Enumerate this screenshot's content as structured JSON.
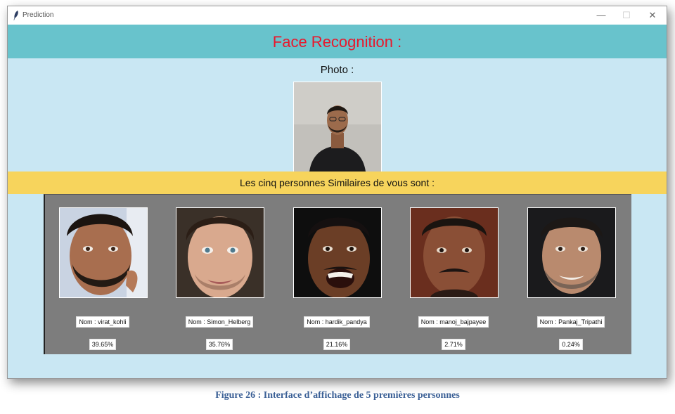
{
  "window": {
    "title": "Prediction",
    "icon": "feather-icon"
  },
  "controls": {
    "minimize": "—",
    "maximize": "☐",
    "close": "✕"
  },
  "header": {
    "title": "Face Recognition :",
    "color": "#e8182c",
    "background": "#68c3cc"
  },
  "photo": {
    "label": "Photo :"
  },
  "band": {
    "text": "Les cinq personnes Similaires de vous sont :",
    "background": "#f7d45c"
  },
  "results": [
    {
      "name": "Nom : virat_kohli",
      "score": "39.65%"
    },
    {
      "name": "Nom : Simon_Helberg",
      "score": "35.76%"
    },
    {
      "name": "Nom : hardik_pandya",
      "score": "21.16%"
    },
    {
      "name": "Nom : manoj_bajpayee",
      "score": "2.71%"
    },
    {
      "name": "Nom : Pankaj_Tripathi",
      "score": "0.24%"
    }
  ],
  "caption": "Figure 26 : Interface d’affichage de 5 premières personnes"
}
